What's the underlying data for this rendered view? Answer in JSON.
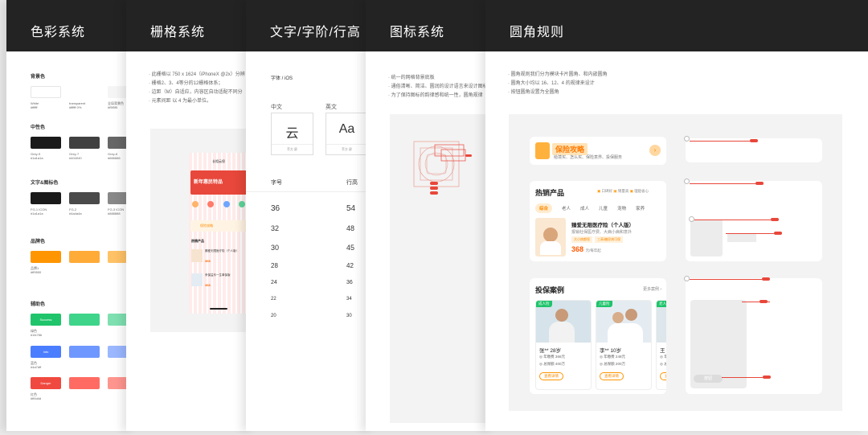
{
  "panels": {
    "color": {
      "title": "色彩系统",
      "sections": {
        "bg": "背景色",
        "neutral": "中性色",
        "text": "文字&图标色",
        "brand": "品牌色",
        "aux": "辅助色"
      },
      "bg_swatches": [
        {
          "name": "White",
          "code": "#ffffff",
          "color": "#ffffff"
        },
        {
          "name": "transparent",
          "code": "#ffffff 0%",
          "color": "#ffffff"
        },
        {
          "name": "全局背景色",
          "code": "#f5f5f5",
          "color": "#f5f5f5"
        }
      ],
      "neutral_swatches": [
        {
          "name": "Grey-9",
          "code": "#1a1a1a",
          "color": "#1a1a1a"
        },
        {
          "name": "Grey-7",
          "code": "#404040",
          "color": "#404040"
        },
        {
          "name": "Grey-6",
          "code": "#666666",
          "color": "#666666"
        }
      ],
      "text_swatches": [
        {
          "name": "FG-1 ICON",
          "code": "#1a1a1a",
          "color": "#1a1a1a"
        },
        {
          "name": "FG-2",
          "code": "#4a4a4a",
          "color": "#4a4a4a"
        },
        {
          "name": "FG-3 ICON",
          "code": "#888888",
          "color": "#888888"
        }
      ],
      "brand_swatches": [
        {
          "name": "品牌1",
          "code": "#ff9500",
          "color": "#ff9500"
        },
        {
          "name": "",
          "code": "",
          "color": "#ffab38"
        },
        {
          "name": "",
          "code": "",
          "color": "#ffc266"
        }
      ],
      "aux_rows": [
        {
          "label": "Success",
          "name": "绿色",
          "code": "#1fc76b",
          "colors": [
            "#1fc46b",
            "#3ed48a",
            "#7ee0b0"
          ]
        },
        {
          "label": "Info",
          "name": "蓝色",
          "code": "#4a7dff",
          "colors": [
            "#4a7dff",
            "#6e98ff",
            "#9ab7ff"
          ]
        },
        {
          "label": "Danger",
          "name": "红色",
          "code": "#ff4d4d",
          "colors": [
            "#f0493f",
            "#ff6b62",
            "#ff958f"
          ]
        }
      ]
    },
    "grid": {
      "title": "栅格系统",
      "bullets": [
        "此栅格以 750 x 1624（iPhoneX @2x）分辨",
        "栅格2、3、4等分的12栅格体系；",
        "边距（M）自适应，内容区自动适配不同分",
        "元素间距 以 4 为最小单位。"
      ],
      "phone": {
        "nav_title": "长相云保",
        "banner": "新年惠民特品",
        "guide": "保险攻略",
        "hot": "热销产品",
        "product1": "臻爱无限医疗险（个人版）",
        "product2": "来保益乐一生单保版",
        "price1": "368",
        "price2": "368"
      }
    },
    "font": {
      "title": "文字/字阶/行高",
      "family": "字体 / iOS",
      "zh": "中文",
      "en": "英文",
      "zh_sample": "云",
      "en_sample": "Aa",
      "zh_font": "苹方 屏",
      "en_font": "苹方 屏",
      "col_size": "字号",
      "col_line": "行高",
      "rows": [
        {
          "size": "36",
          "line": "54"
        },
        {
          "size": "32",
          "line": "48"
        },
        {
          "size": "30",
          "line": "45"
        },
        {
          "size": "28",
          "line": "42"
        },
        {
          "size": "24",
          "line": "36"
        },
        {
          "size": "22",
          "line": "34"
        },
        {
          "size": "20",
          "line": "30"
        }
      ]
    },
    "icon": {
      "title": "图标系统",
      "bullets": [
        "统一的网格背景底板",
        "通俗清晰、简洁、圆润的设计语言来设计图标",
        "为了保持图标的韵律感和统一性，圆角规律"
      ]
    },
    "radius": {
      "title": "圆角规则",
      "bullets": [
        "圆角规则我们分为模块卡片圆角、和内嵌圆角",
        "圆角大小均以 16、12、4 的规律来设计",
        "按钮圆角设置为全圆角"
      ],
      "guide": {
        "title": "保险攻略",
        "desc": "给境买、怎么买、保险意界、投保服务"
      },
      "hot": {
        "title": "热销产品",
        "tags": [
          "口碑好",
          "销量高",
          "理赔省心"
        ],
        "tabs": [
          "综合",
          "老人",
          "成人",
          "儿童",
          "宠物",
          "家养"
        ],
        "product_name": "臻爱无限医疗险（个人版）",
        "product_desc": "报销社保医疗费、大病小病和意外",
        "badges": [
          "大小病都保",
          "三高/糖尿病可保"
        ],
        "price": "368",
        "price_unit": "元/每年起"
      },
      "cases": {
        "title": "投保案例",
        "more": "更多案例 ›",
        "items": [
          {
            "tag": "成人险",
            "name": "张** 28岁",
            "fee": "年缴费 366元",
            "cover": "总保额 400万",
            "btn": "查看详情"
          },
          {
            "tag": "儿童险",
            "name": "李** 10岁",
            "fee": "年缴费 248元",
            "cover": "总保额 200万",
            "btn": "查看详情"
          },
          {
            "tag": "老人险",
            "name": "王",
            "fee": "年",
            "cover": "总",
            "btn": "查"
          }
        ]
      },
      "pill_label": "按钮"
    }
  }
}
